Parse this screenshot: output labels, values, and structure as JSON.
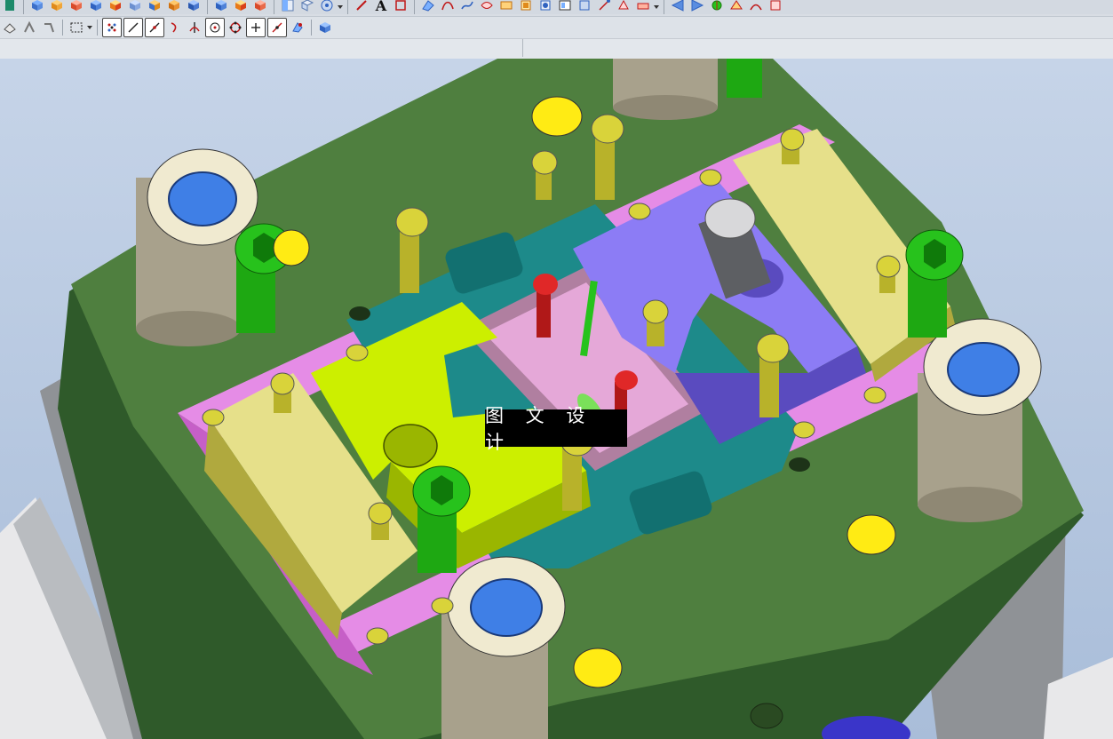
{
  "toolbar": {
    "row1_icons": [
      "new-icon",
      "cube-icon",
      "cube-icon",
      "cube-icon",
      "cube-icon",
      "cube-icon",
      "cube-icon",
      "cube-icon",
      "cube-icon",
      "cube-icon",
      "cube-icon",
      "cube-icon",
      "cube-icon",
      "sketch-icon",
      "text-icon",
      "rectangle-icon",
      "surface-icon",
      "curve-icon",
      "curve-icon",
      "curve-icon",
      "surface-icon",
      "surface-icon",
      "surface-icon",
      "surface-icon",
      "surface-icon",
      "surface-icon",
      "surface-icon",
      "surface-icon",
      "view-icon",
      "view-icon",
      "view-icon",
      "view-icon",
      "view-icon",
      "view-icon"
    ],
    "row1_text_tool": "A",
    "row2_icons": [
      "eraser-icon",
      "snap-icon",
      "snap-icon",
      "select-box-icon",
      "point-snap-icon",
      "line-snap-icon",
      "midpoint-icon",
      "curve-snap-icon",
      "intersection-icon",
      "circle-center-icon",
      "quadrant-icon",
      "plus-snap-icon",
      "tangent-icon",
      "face-snap-icon",
      "solid-filter-icon"
    ]
  },
  "viewport": {
    "background_top": "#c6d4e8",
    "background_bottom": "#a9bdd9",
    "watermark_text": "图 文 设 计"
  },
  "colors": {
    "plate_green": "#4f7f3f",
    "plate_side_green": "#2f5a2a",
    "base_gray": "#8f9296",
    "insert_yellow": "#ccef00",
    "insert_purple": "#8c7cf5",
    "slider_khaki": "#e6e08a",
    "pink_strip": "#e58ce6",
    "teal_core": "#1d8a8a",
    "bolt_green": "#27c21c",
    "bushing_cream": "#f0ead0",
    "bushing_blue": "#3f7fe6",
    "screw_yellow": "#d9d33a"
  }
}
